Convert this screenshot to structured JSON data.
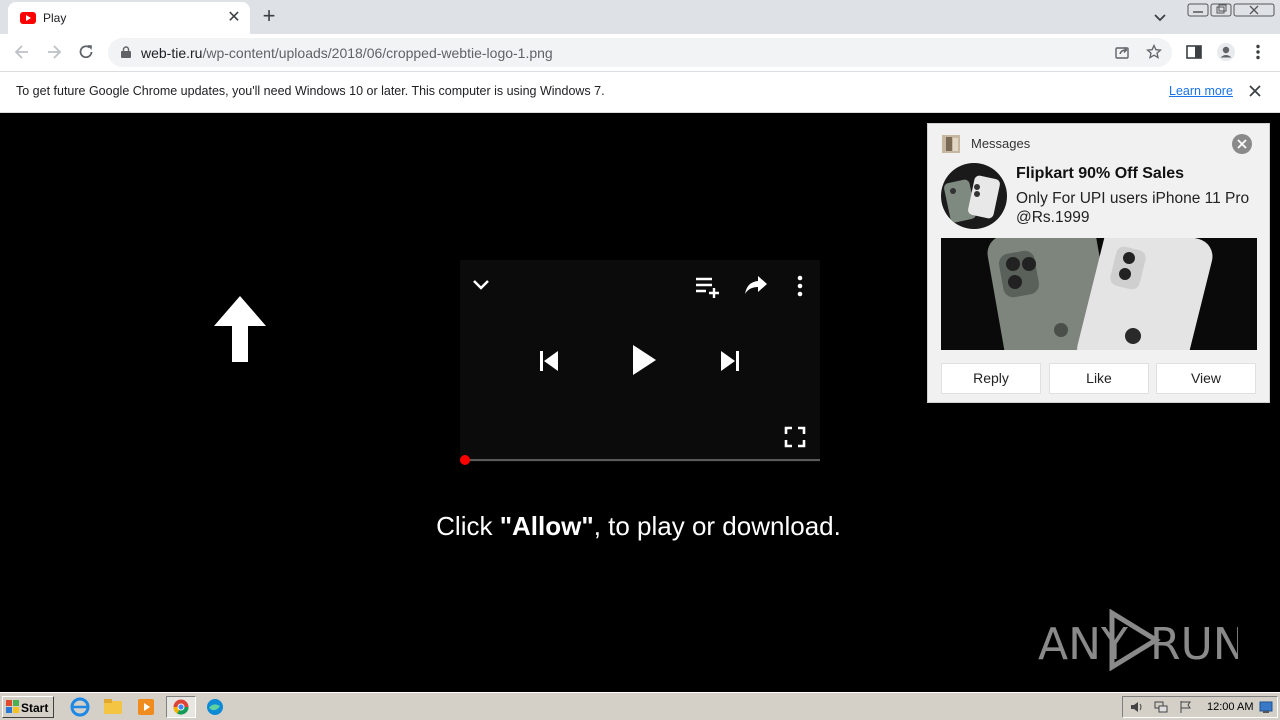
{
  "browser": {
    "tab": {
      "title": "Play",
      "favicon": "youtube-icon"
    },
    "url": {
      "host": "web-tie.ru",
      "path": "/wp-content/uploads/2018/06/cropped-webtie-logo-1.png"
    },
    "infobar": {
      "message": "To get future Google Chrome updates, you'll need Windows 10 or later. This computer is using Windows 7.",
      "link": "Learn more"
    }
  },
  "page": {
    "player_icons": [
      "chevron-down-icon",
      "playlist-add-icon",
      "share-icon",
      "more-vert-icon",
      "skip-previous-icon",
      "play-icon",
      "skip-next-icon",
      "fullscreen-icon"
    ],
    "progress": 0,
    "cta": {
      "prefix": "Click ",
      "bold": "\"Allow\"",
      "suffix": ", to play or download."
    }
  },
  "notification": {
    "app": "Messages",
    "title": "Flipkart 90% Off Sales",
    "body": "Only For UPI users iPhone 11 Pro @Rs.1999",
    "buttons": [
      "Reply",
      "Like",
      "View"
    ]
  },
  "watermark": {
    "text_left": "ANY",
    "text_right": "RUN"
  },
  "taskbar": {
    "start": "Start",
    "clock": "12:00 AM"
  },
  "colors": {
    "accent_link": "#1a73e8",
    "progress_dot": "#ff0000",
    "background": "#000000"
  }
}
